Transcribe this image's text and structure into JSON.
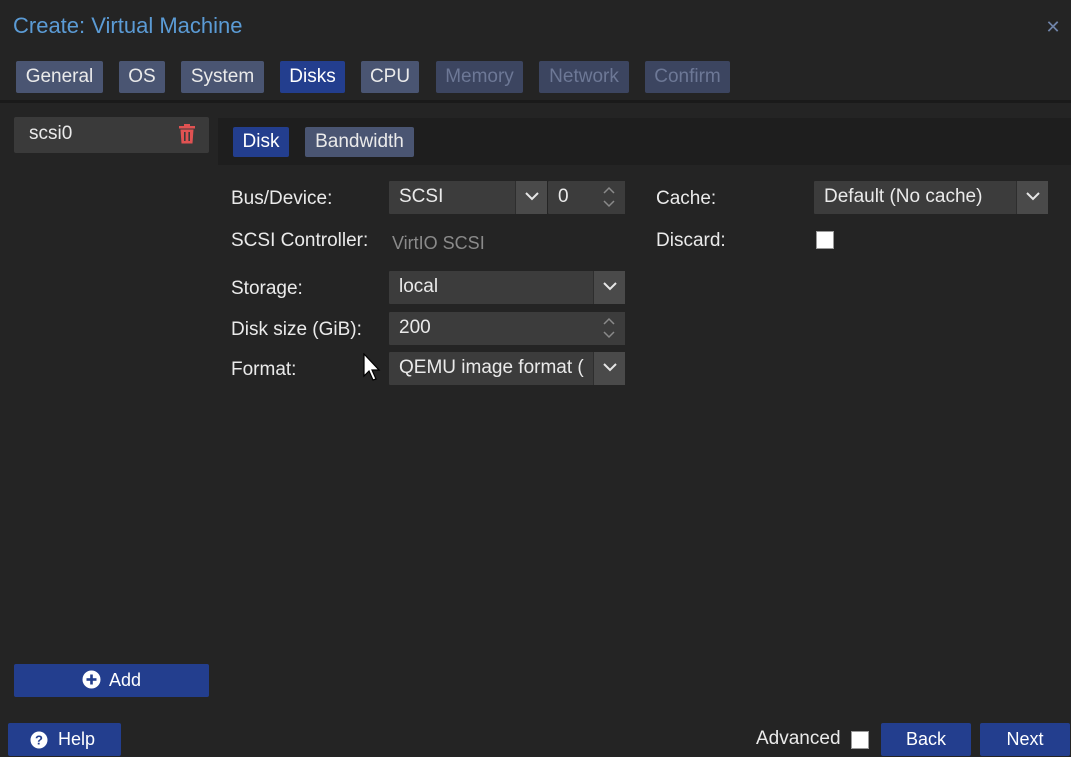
{
  "window": {
    "title": "Create: Virtual Machine",
    "close_icon": "close-icon"
  },
  "wizard_tabs": [
    {
      "label": "General",
      "state": "normal"
    },
    {
      "label": "OS",
      "state": "normal"
    },
    {
      "label": "System",
      "state": "normal"
    },
    {
      "label": "Disks",
      "state": "active"
    },
    {
      "label": "CPU",
      "state": "normal"
    },
    {
      "label": "Memory",
      "state": "disabled"
    },
    {
      "label": "Network",
      "state": "disabled"
    },
    {
      "label": "Confirm",
      "state": "disabled"
    }
  ],
  "disk_list": {
    "items": [
      {
        "label": "scsi0",
        "icon": "trash-icon"
      }
    ],
    "add_label": "Add"
  },
  "sub_tabs": [
    {
      "label": "Disk",
      "state": "active"
    },
    {
      "label": "Bandwidth",
      "state": "normal"
    }
  ],
  "form": {
    "bus_device": {
      "label": "Bus/Device:",
      "bus": "SCSI",
      "device": "0"
    },
    "scsi_controller": {
      "label": "SCSI Controller:",
      "value": "VirtIO SCSI"
    },
    "storage": {
      "label": "Storage:",
      "value": "local"
    },
    "disk_size": {
      "label": "Disk size (GiB):",
      "value": "200"
    },
    "format": {
      "label": "Format:",
      "value": "QEMU image format ("
    },
    "cache": {
      "label": "Cache:",
      "value": "Default (No cache)"
    },
    "discard": {
      "label": "Discard:",
      "checked": false
    }
  },
  "footer": {
    "help_label": "Help",
    "advanced_label": "Advanced",
    "advanced_checked": false,
    "back_label": "Back",
    "next_label": "Next"
  },
  "colors": {
    "accent": "#233e8e",
    "title": "#5b9bd5",
    "tab_normal": "#4a5572",
    "danger": "#e05252"
  }
}
